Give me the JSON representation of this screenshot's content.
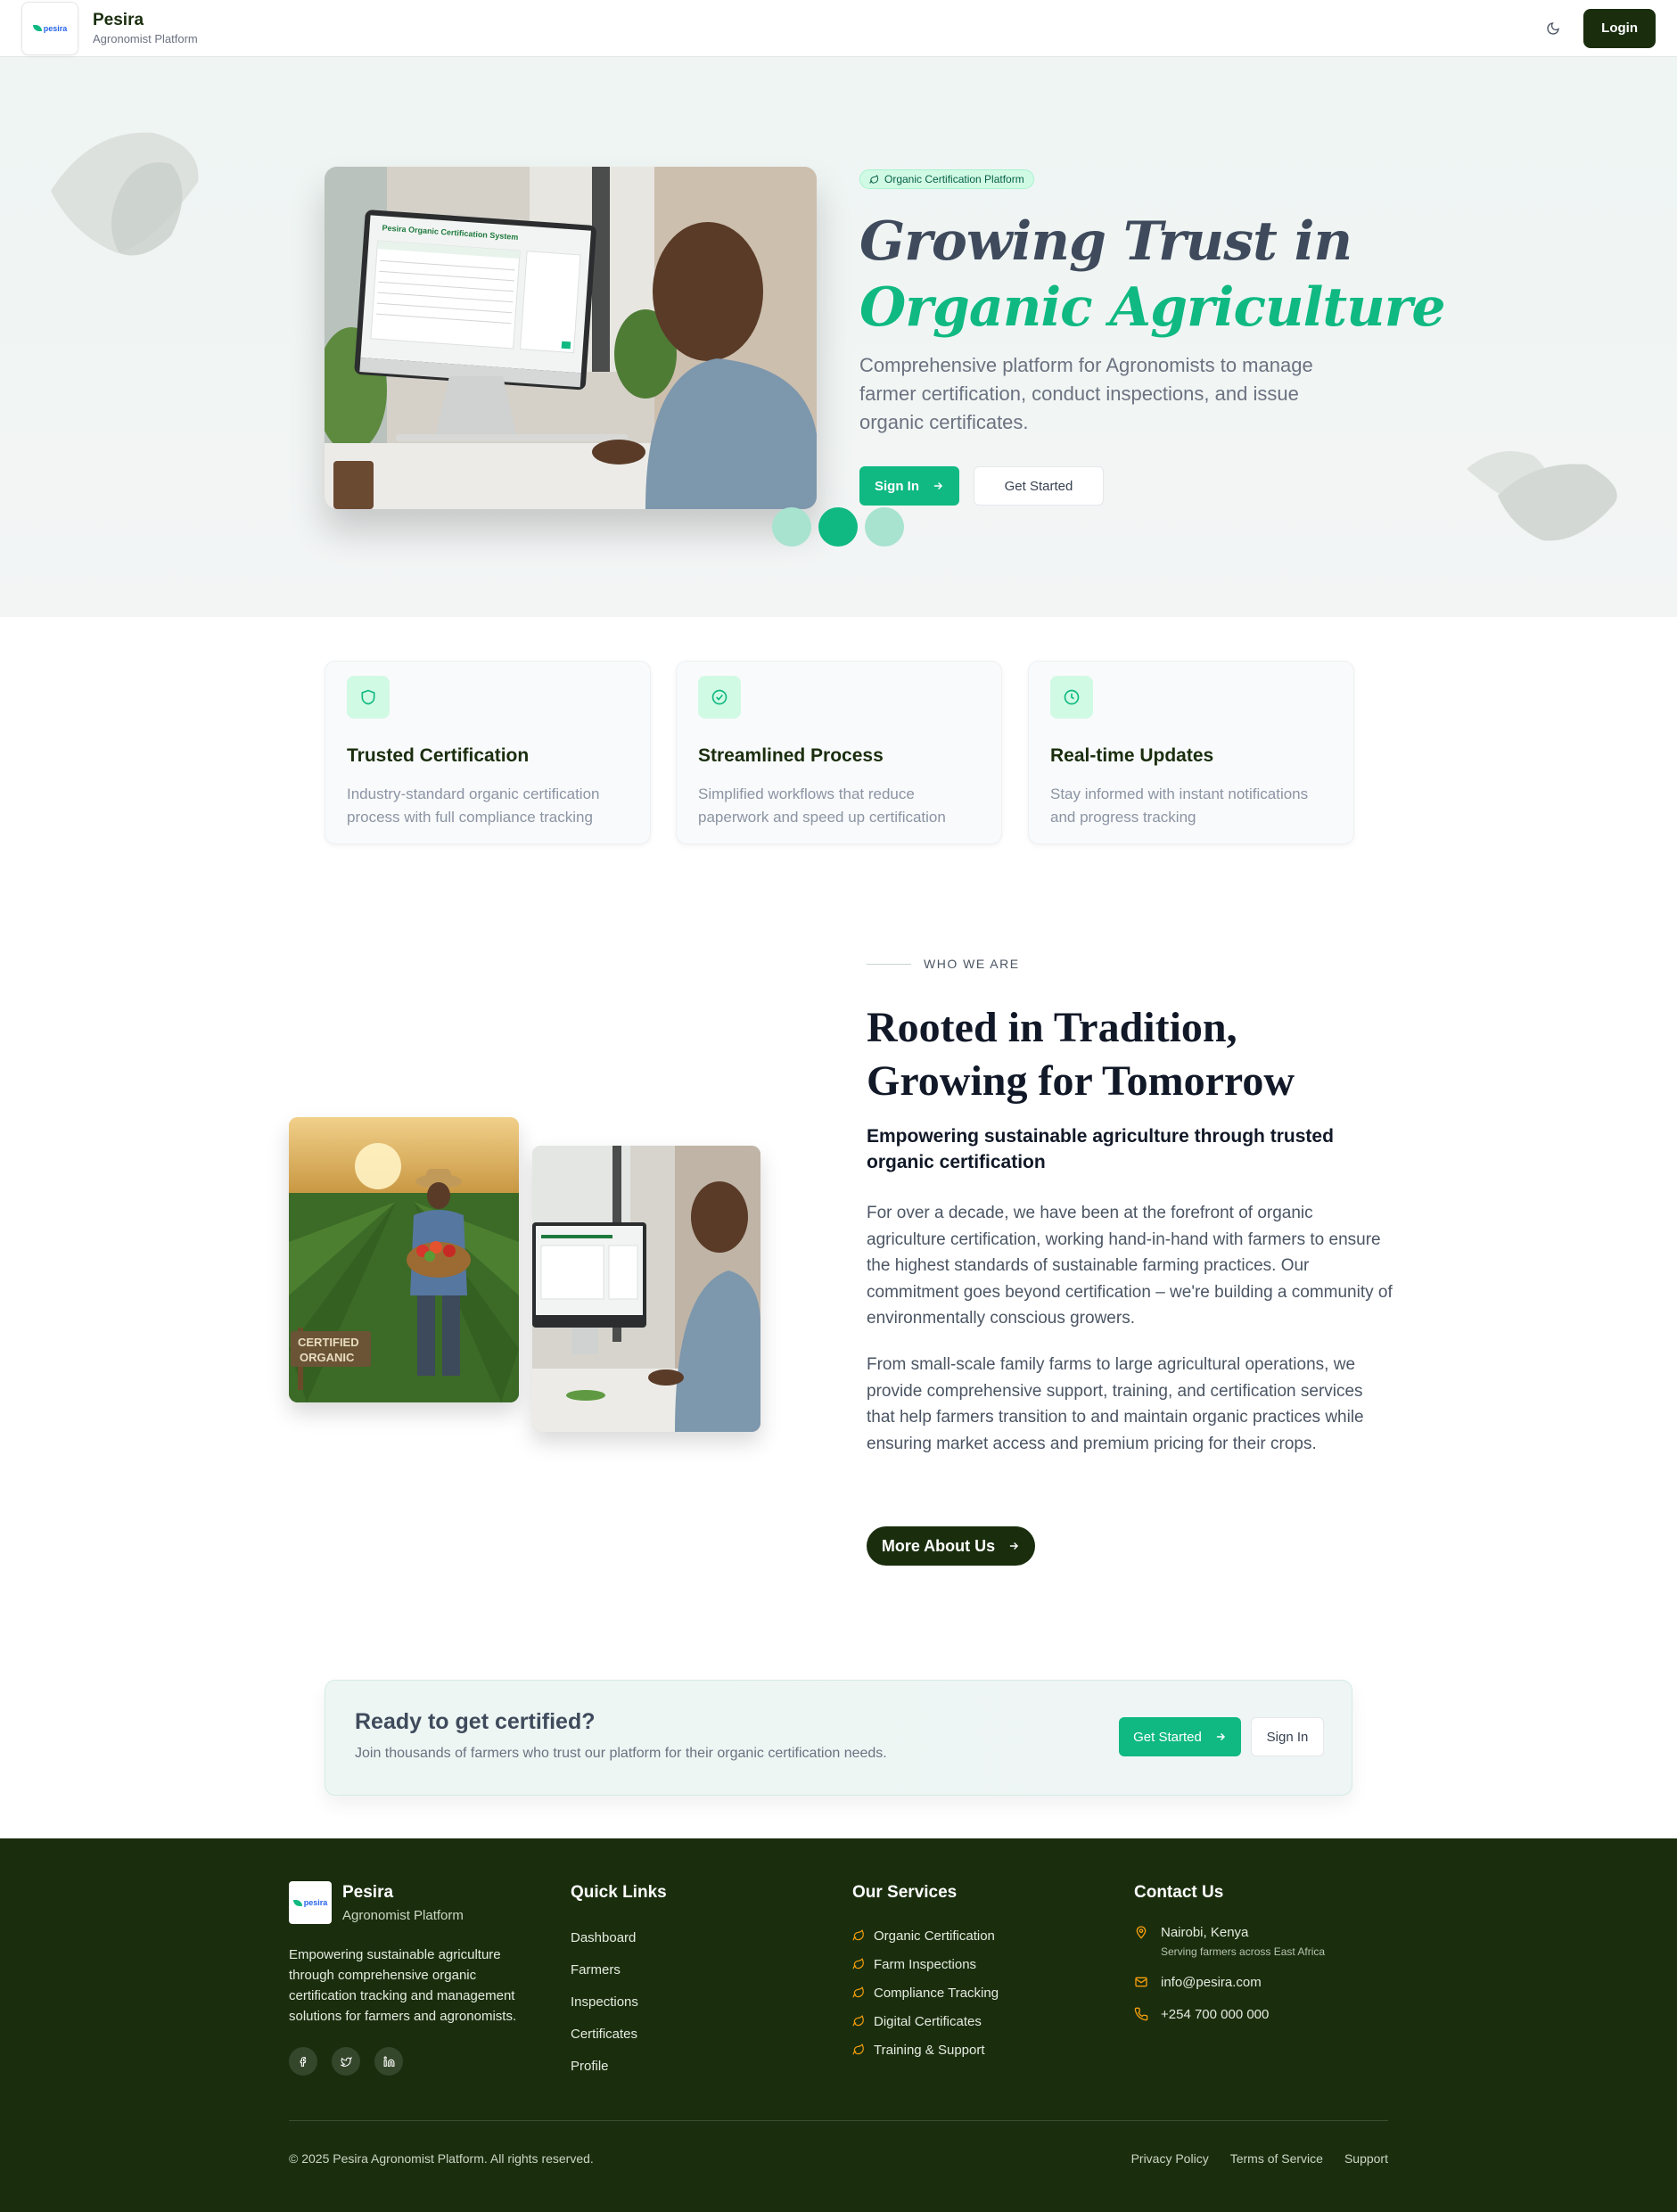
{
  "header": {
    "logo_text": "pesira",
    "brand": "Pesira",
    "subtitle": "Agronomist Platform",
    "theme_icon": "moon-icon",
    "login_label": "Login"
  },
  "hero": {
    "badge": "Organic Certification Platform",
    "title_line1": "Growing Trust in",
    "title_line2": "Organic Agriculture",
    "description": "Comprehensive platform for Agronomists to manage farmer certification, conduct inspections, and issue organic certificates.",
    "signin_label": "Sign In",
    "get_started_label": "Get Started",
    "screen_title": "Pesira Organic Certification System",
    "carousel": {
      "slides": 3,
      "active": 2
    }
  },
  "features": [
    {
      "icon": "shield-icon",
      "title": "Trusted Certification",
      "desc": "Industry-standard organic certification process with full compliance tracking"
    },
    {
      "icon": "check-circle-icon",
      "title": "Streamlined Process",
      "desc": "Simplified workflows that reduce paperwork and speed up certification"
    },
    {
      "icon": "clock-icon",
      "title": "Real-time Updates",
      "desc": "Stay informed with instant notifications and progress tracking"
    }
  ],
  "who": {
    "kicker": "WHO WE ARE",
    "title_line1": "Rooted in Tradition,",
    "title_line2": "Growing for Tomorrow",
    "subtitle": "Empowering sustainable agriculture through trusted organic certification",
    "p1": "For over a decade, we have been at the forefront of organic agriculture certification, working hand-in-hand with farmers to ensure the highest standards of sustainable farming practices. Our commitment goes beyond certification – we're building a community of environmentally conscious growers.",
    "p2": "From small-scale family farms to large agricultural operations, we provide comprehensive support, training, and certification services that help farmers transition to and maintain organic practices while ensuring market access and premium pricing for their crops.",
    "button": "More About Us",
    "sign_text_1": "CERTIFIED",
    "sign_text_2": "ORGANIC"
  },
  "cta": {
    "title": "Ready to get certified?",
    "desc": "Join thousands of farmers who trust our platform for their organic certification needs.",
    "primary": "Get Started",
    "secondary": "Sign In"
  },
  "footer": {
    "brand": "Pesira",
    "subtitle": "Agronomist Platform",
    "desc": "Empowering sustainable agriculture through comprehensive organic certification tracking and management solutions for farmers and agronomists.",
    "quick_links_title": "Quick Links",
    "quick_links": [
      "Dashboard",
      "Farmers",
      "Inspections",
      "Certificates",
      "Profile"
    ],
    "services_title": "Our Services",
    "services": [
      "Organic Certification",
      "Farm Inspections",
      "Compliance Tracking",
      "Digital Certificates",
      "Training & Support"
    ],
    "contact_title": "Contact Us",
    "location": "Nairobi, Kenya",
    "location_sub": "Serving farmers across East Africa",
    "email": "info@pesira.com",
    "phone": "+254 700 000 000",
    "copyright": "© 2025 Pesira Agronomist Platform. All rights reserved.",
    "legal": [
      "Privacy Policy",
      "Terms of Service",
      "Support"
    ]
  },
  "colors": {
    "brand_dark": "#1a2e0e",
    "accent": "#10b981",
    "footer_icon": "#f59e0b"
  }
}
